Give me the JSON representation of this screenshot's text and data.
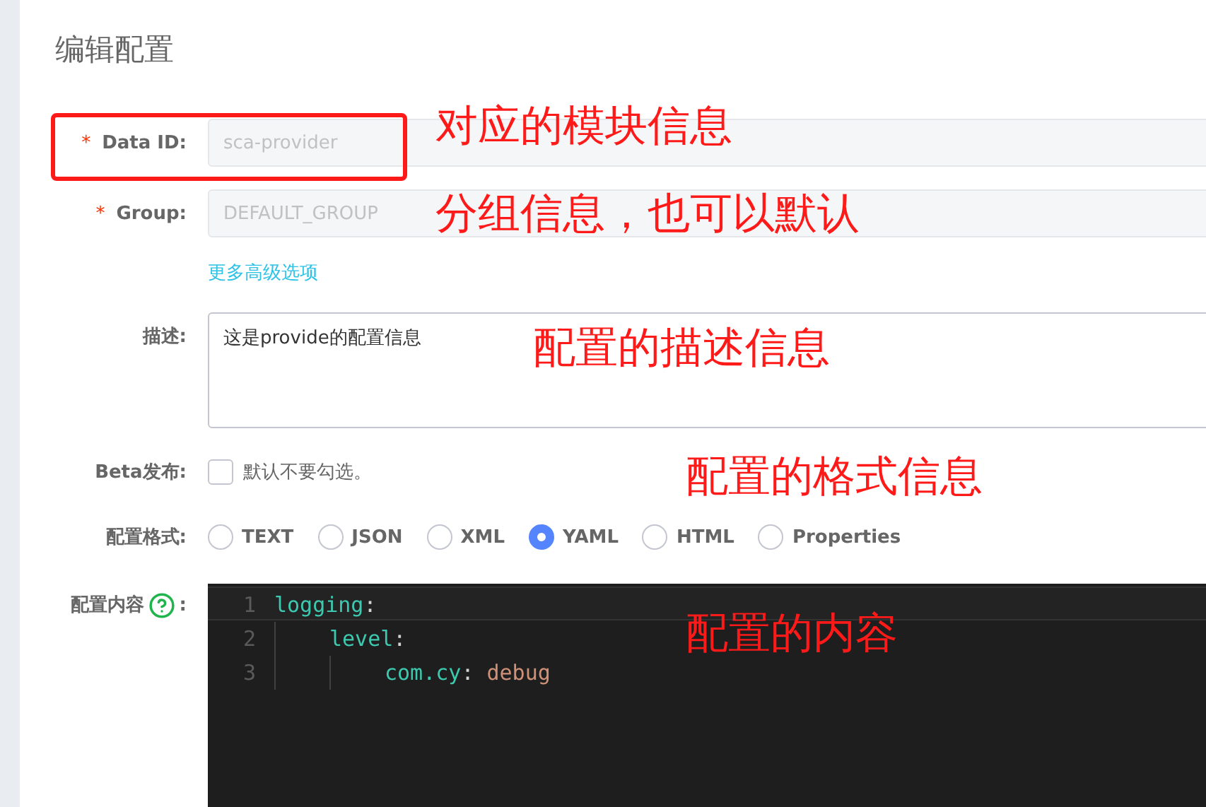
{
  "title": "编辑配置",
  "fields": [
    {
      "label": "Data ID:",
      "required_mark": "*",
      "value": "sca-provider",
      "disabled": true,
      "highlighted": true,
      "note": "对应的模块信息"
    },
    {
      "label": "Group:",
      "required_mark": "*",
      "value": "DEFAULT_GROUP",
      "disabled": true,
      "note": "分组信息，也可以默认"
    }
  ],
  "advanced_link": "更多高级选项",
  "description": {
    "label": "描述:",
    "value": "这是provide的配置信息",
    "note": "配置的描述信息"
  },
  "beta": {
    "label": "Beta发布:",
    "checked": false,
    "hint": "默认不要勾选。"
  },
  "format": {
    "label": "配置格式:",
    "note": "配置的格式信息",
    "options": [
      {
        "label": "TEXT",
        "selected": false
      },
      {
        "label": "JSON",
        "selected": false
      },
      {
        "label": "XML",
        "selected": false
      },
      {
        "label": "YAML",
        "selected": true
      },
      {
        "label": "HTML",
        "selected": false
      },
      {
        "label": "Properties",
        "selected": false
      }
    ]
  },
  "content": {
    "label": "配置内容",
    "colon": ":",
    "note": "配置的内容",
    "lines": [
      {
        "number": "1",
        "key": "logging",
        "sep": ":",
        "active": true,
        "children": [
          {
            "number": "2",
            "key": "level",
            "sep": ":",
            "active": false,
            "children": [
              {
                "number": "3",
                "key": "com.cy",
                "sep": ":",
                "value": "debug",
                "active": false
              }
            ]
          }
        ]
      }
    ]
  }
}
